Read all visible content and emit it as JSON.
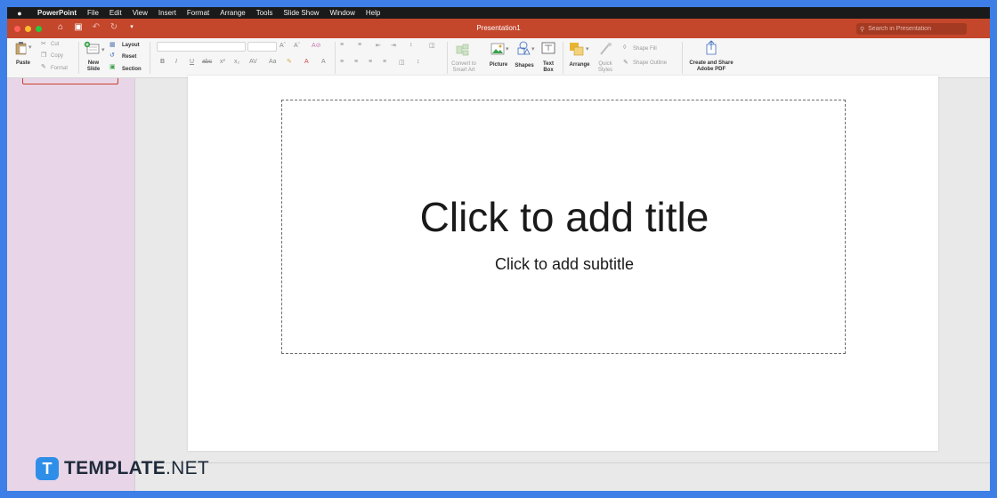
{
  "menubar": {
    "apple": "",
    "items": [
      "PowerPoint",
      "File",
      "Edit",
      "View",
      "Insert",
      "Format",
      "Arrange",
      "Tools",
      "Slide Show",
      "Window",
      "Help"
    ]
  },
  "titlebar": {
    "title": "Presentation1",
    "search_placeholder": "Search in Presentation",
    "colors": {
      "bar": "#c4462b",
      "close": "#ff5f57",
      "minimize": "#febc2e",
      "zoom": "#28c840"
    }
  },
  "ribbon": {
    "paste": "Paste",
    "cut": "Cut",
    "copy": "Copy",
    "format": "Format",
    "new_slide_1": "New",
    "new_slide_2": "Slide",
    "layout": "Layout",
    "reset": "Reset",
    "section": "Section",
    "convert_1": "Convert to",
    "convert_2": "Smart Art",
    "picture": "Picture",
    "shapes": "Shapes",
    "textbox_1": "Text",
    "textbox_2": "Box",
    "arrange": "Arrange",
    "quick_1": "Quick",
    "quick_2": "Styles",
    "shape_fill": "Shape Fill",
    "shape_outline": "Shape Outline",
    "pdf_1": "Create and Share",
    "pdf_2": "Adobe PDF"
  },
  "slide": {
    "title_placeholder": "Click to add title",
    "subtitle_placeholder": "Click to add subtitle"
  },
  "watermark": {
    "logo": "T",
    "brand": "TEMPLATE",
    "tld": ".NET"
  }
}
